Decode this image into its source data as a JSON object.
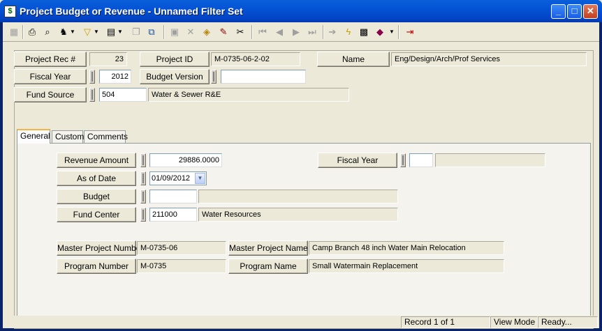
{
  "window": {
    "title": "Project Budget or Revenue - Unnamed Filter Set",
    "minimize": "_",
    "maximize": "□",
    "close": "✕"
  },
  "toolbar": {
    "icons": [
      "grid-icon",
      "print-icon",
      "preview-icon",
      "filter-find-icon",
      "filter-icon",
      "new-record-icon",
      "copy-icon",
      "duplicate-icon",
      "save-icon",
      "delete-icon",
      "open-icon",
      "edit-icon",
      "cut-icon",
      "first-icon",
      "prev-icon",
      "next-icon",
      "last-icon",
      "goto-icon",
      "lightning-icon",
      "report-icon",
      "book-icon",
      "exit-icon"
    ]
  },
  "header": {
    "project_rec_label": "Project Rec #",
    "project_rec_value": "23",
    "project_id_label": "Project ID",
    "project_id_value": "M-0735-06-2-02",
    "name_label": "Name",
    "name_value": "Eng/Design/Arch/Prof Services",
    "fiscal_year_label": "Fiscal Year",
    "fiscal_year_value": "2012",
    "budget_version_label": "Budget Version",
    "budget_version_value": "",
    "fund_source_label": "Fund Source",
    "fund_source_code": "504",
    "fund_source_desc": "Water & Sewer R&E"
  },
  "tabs": [
    {
      "label": "General",
      "active": true
    },
    {
      "label": "Custom",
      "active": false
    },
    {
      "label": "Comments",
      "active": false
    }
  ],
  "general": {
    "revenue_amount_label": "Revenue Amount",
    "revenue_amount_value": "29886.0000",
    "fiscal_year_label": "Fiscal Year",
    "fiscal_year_code": "",
    "fiscal_year_desc": "",
    "as_of_date_label": "As of Date",
    "as_of_date_value": "01/09/2012",
    "budget_label": "Budget",
    "budget_code": "",
    "budget_desc": "",
    "fund_center_label": "Fund Center",
    "fund_center_code": "211000",
    "fund_center_desc": "Water Resources",
    "master_project_number_label": "Master Project Number",
    "master_project_number_value": "M-0735-06",
    "master_project_name_label": "Master Project Name",
    "master_project_name_value": "Camp Branch 48 inch Water Main Relocation",
    "program_number_label": "Program Number",
    "program_number_value": "M-0735",
    "program_name_label": "Program Name",
    "program_name_value": "Small Watermain Replacement"
  },
  "statusbar": {
    "record": "Record 1 of 1",
    "mode": "View Mode",
    "state": "Ready..."
  }
}
